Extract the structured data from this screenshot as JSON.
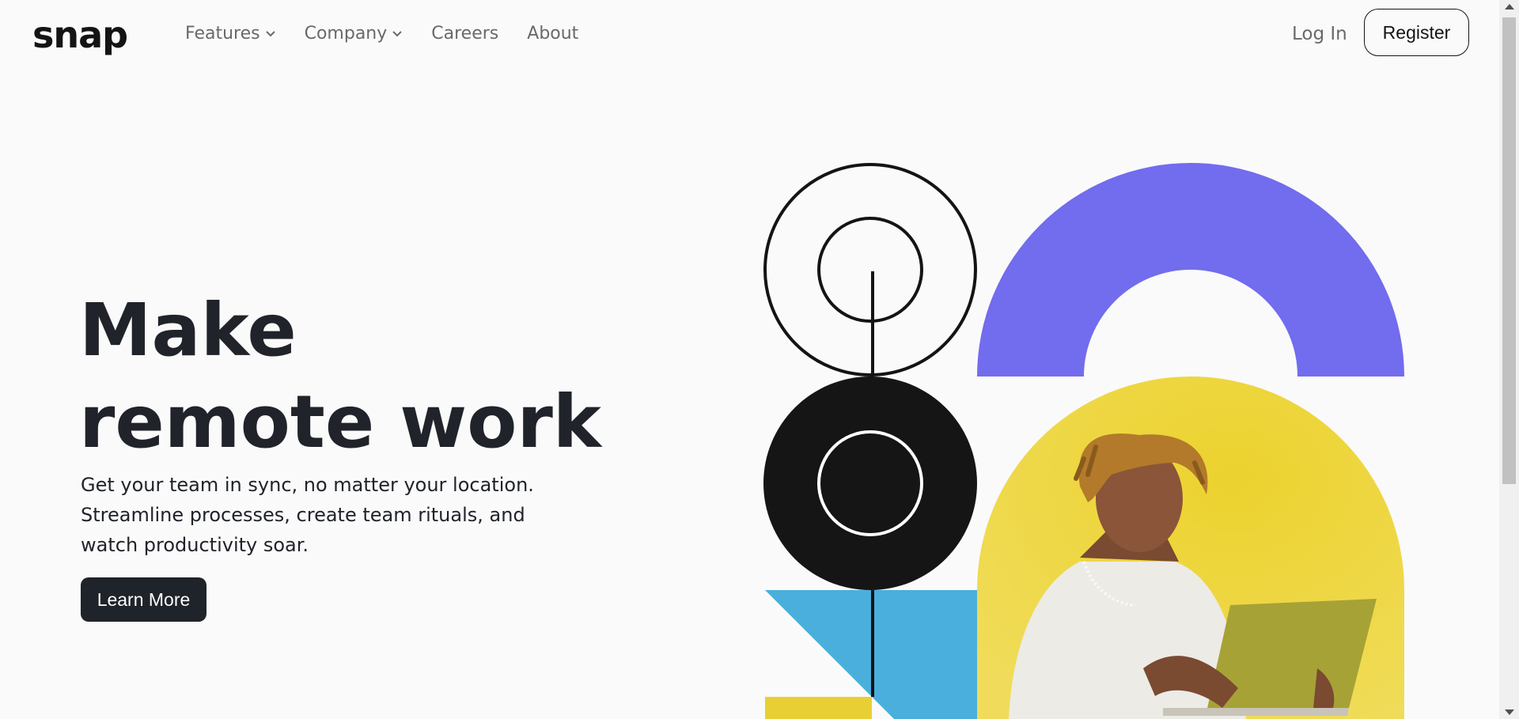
{
  "brand": {
    "logo": "snap"
  },
  "nav": {
    "items": [
      {
        "label": "Features",
        "has_dropdown": true
      },
      {
        "label": "Company",
        "has_dropdown": true
      },
      {
        "label": "Careers",
        "has_dropdown": false
      },
      {
        "label": "About",
        "has_dropdown": false
      }
    ],
    "login_label": "Log In",
    "register_label": "Register"
  },
  "hero": {
    "headline_line1": "Make",
    "headline_line2": "remote work",
    "subtext": "Get your team in sync, no matter your location. Streamline processes, create team rituals, and watch productivity soar.",
    "cta_label": "Learn More"
  },
  "colors": {
    "background": "#fafafa",
    "text_dark": "#20232a",
    "nav_text": "#696969",
    "purple": "#726cee",
    "yellow": "#e8d034",
    "blue": "#4aafdc",
    "black": "#141414"
  }
}
